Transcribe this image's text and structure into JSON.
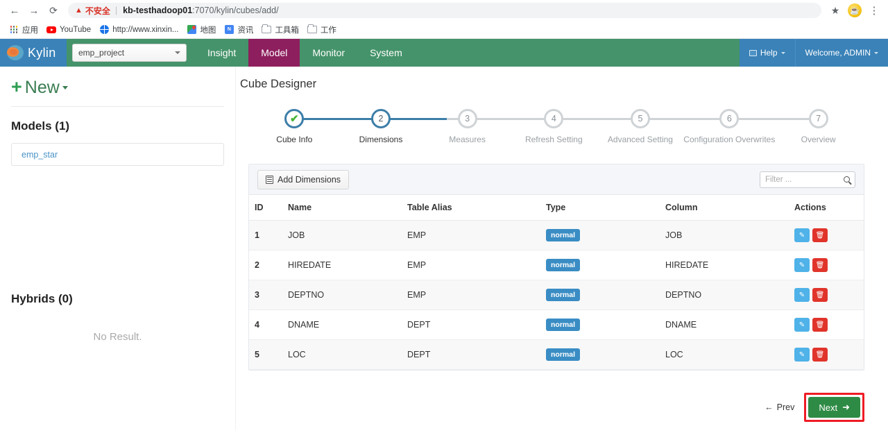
{
  "browser": {
    "back_icon": "back-arrow-icon",
    "forward_icon": "forward-arrow-icon",
    "reload_icon": "reload-icon",
    "security_warning": "不安全",
    "url_host": "kb-testhadoop01",
    "url_rest": ":7070/kylin/cubes/add/",
    "star_icon": "★",
    "menu_icon": "⋮",
    "bookmarks": [
      {
        "label": "应用",
        "icon": "apps-grid-icon"
      },
      {
        "label": "YouTube",
        "icon": "youtube-icon"
      },
      {
        "label": "http://www.xinxin...",
        "icon": "globe-icon"
      },
      {
        "label": "地图",
        "icon": "maps-icon"
      },
      {
        "label": "资讯",
        "icon": "news-icon"
      },
      {
        "label": "工具箱",
        "icon": "folder-icon"
      },
      {
        "label": "工作",
        "icon": "folder-icon"
      }
    ]
  },
  "navbar": {
    "brand": "Kylin",
    "project": "emp_project",
    "items": [
      {
        "label": "Insight",
        "active": false
      },
      {
        "label": "Model",
        "active": true
      },
      {
        "label": "Monitor",
        "active": false
      },
      {
        "label": "System",
        "active": false
      }
    ],
    "help": "Help",
    "user": "Welcome, ADMIN"
  },
  "sidebar": {
    "new_label": "New",
    "models_heading": "Models (1)",
    "models": [
      "emp_star"
    ],
    "hybrids_heading": "Hybrids (0)",
    "hybrids_empty": "No Result."
  },
  "main": {
    "title": "Cube Designer",
    "steps": [
      {
        "num": "1",
        "label": "Cube Info",
        "state": "done"
      },
      {
        "num": "2",
        "label": "Dimensions",
        "state": "active"
      },
      {
        "num": "3",
        "label": "Measures",
        "state": "todo"
      },
      {
        "num": "4",
        "label": "Refresh Setting",
        "state": "todo"
      },
      {
        "num": "5",
        "label": "Advanced Setting",
        "state": "todo"
      },
      {
        "num": "6",
        "label": "Configuration Overwrites",
        "state": "todo"
      },
      {
        "num": "7",
        "label": "Overview",
        "state": "todo"
      }
    ],
    "toolbar": {
      "add_dimensions": "Add Dimensions",
      "filter_placeholder": "Filter ..."
    },
    "table": {
      "headers": [
        "ID",
        "Name",
        "Table Alias",
        "Type",
        "Column",
        "Actions"
      ],
      "rows": [
        {
          "id": "1",
          "name": "JOB",
          "alias": "EMP",
          "type": "normal",
          "column": "JOB"
        },
        {
          "id": "2",
          "name": "HIREDATE",
          "alias": "EMP",
          "type": "normal",
          "column": "HIREDATE"
        },
        {
          "id": "3",
          "name": "DEPTNO",
          "alias": "EMP",
          "type": "normal",
          "column": "DEPTNO"
        },
        {
          "id": "4",
          "name": "DNAME",
          "alias": "DEPT",
          "type": "normal",
          "column": "DNAME"
        },
        {
          "id": "5",
          "name": "LOC",
          "alias": "DEPT",
          "type": "normal",
          "column": "LOC"
        }
      ]
    },
    "footer": {
      "prev": "Prev",
      "next": "Next"
    }
  },
  "colors": {
    "navbar_blue": "#3a82b8",
    "navbar_green": "#45936a",
    "active_tab": "#8e1f5e",
    "step_blue": "#3d7ea8",
    "badge_blue": "#3a8dc4",
    "next_green": "#2e8b45",
    "highlight_red": "#ee1c25",
    "edit_blue": "#4fb2e8",
    "delete_red": "#e0342b"
  }
}
